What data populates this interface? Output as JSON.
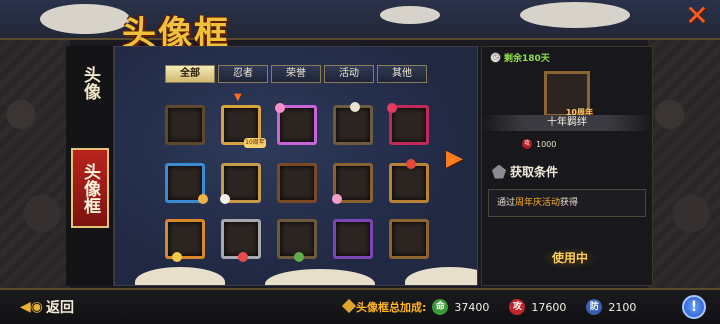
{
  "header": {
    "title": "头像框",
    "close_icon": "close-x-icon"
  },
  "sidebar": {
    "items": [
      {
        "label": "头像",
        "active": false
      },
      {
        "label": "头像框",
        "active": true
      }
    ]
  },
  "tabs": [
    {
      "label": "全部",
      "active": true
    },
    {
      "label": "忍者",
      "active": false
    },
    {
      "label": "荣誉",
      "active": false
    },
    {
      "label": "活动",
      "active": false
    },
    {
      "label": "其他",
      "active": false
    }
  ],
  "grid": {
    "rows": 3,
    "cols": 5,
    "selected_index": 1,
    "badges": {
      "selected_frame": "10周年"
    }
  },
  "info_panel": {
    "remaining": "剩余180天",
    "frame_name": "十年羁绊",
    "price": "1000",
    "condition_title": "获取条件",
    "condition_prefix": "通过",
    "condition_highlight": "周年庆活动",
    "condition_suffix": "获得",
    "use_label": "使用中"
  },
  "bottom": {
    "back_label": "返回",
    "bonus_label": "头像框总加成:",
    "stats": [
      {
        "icon": "命",
        "value": "37400",
        "color": "#3a9a3a"
      },
      {
        "icon": "攻",
        "value": "17600",
        "color": "#c0262c"
      },
      {
        "icon": "防",
        "value": "2100",
        "color": "#3b5fb0"
      }
    ],
    "help_label": "!"
  }
}
